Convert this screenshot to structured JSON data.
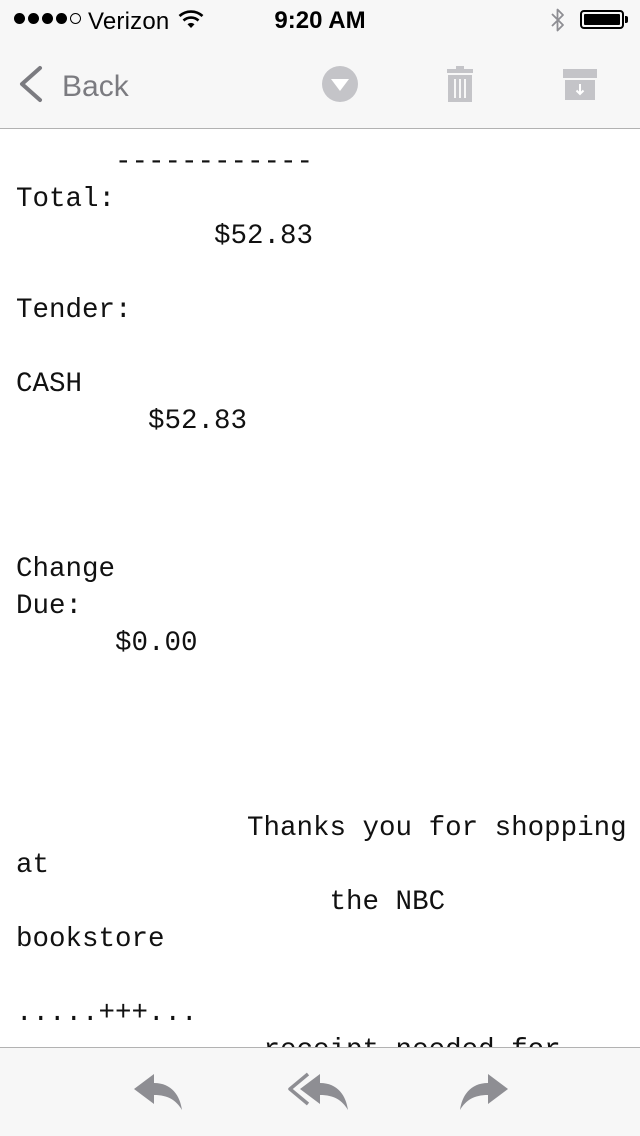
{
  "status_bar": {
    "carrier": "Verizon",
    "time": "9:20 AM",
    "signal_bars_filled": 4,
    "signal_bars_total": 5,
    "icons": [
      "wifi-icon",
      "bluetooth-icon",
      "battery-icon"
    ]
  },
  "nav": {
    "back_label": "Back",
    "icons": [
      "chevron-left-icon",
      "more-dropdown-icon",
      "trash-icon",
      "archive-icon"
    ],
    "icon_color": "#c4c4c8"
  },
  "message": {
    "receipt_text": "      ------------\nTotal:\n            $52.83\n\nTender:\n\nCASH\n        $52.83\n\n\n\nChange\nDue:\n      $0.00\n\n\n\n\n              Thanks you for shopping\nat\n                   the NBC\nbookstore\n\n.....+++...\n               receipt needed for"
  },
  "toolbar": {
    "icons": [
      "reply-icon",
      "reply-all-icon",
      "forward-icon"
    ],
    "icon_color": "#8e8e93"
  }
}
